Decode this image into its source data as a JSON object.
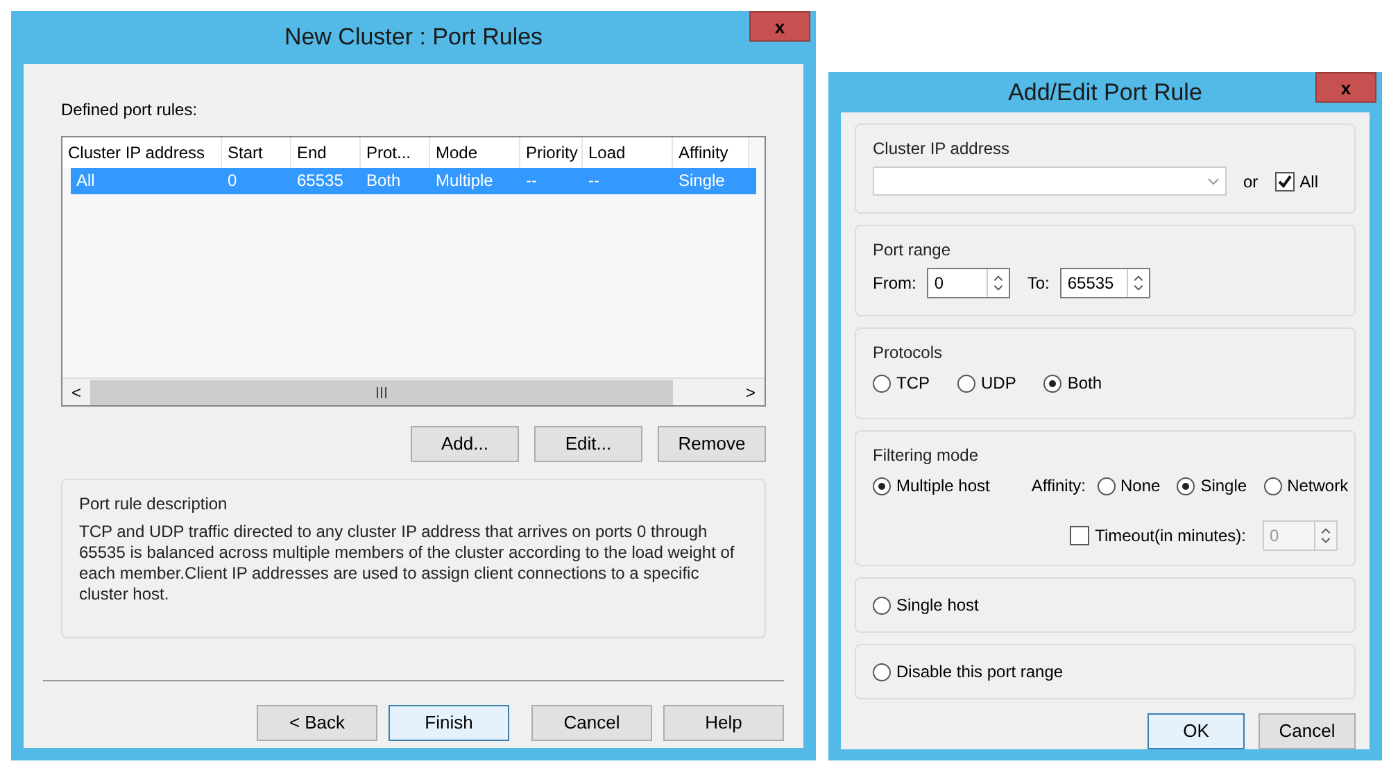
{
  "port_rules_dialog": {
    "title": "New Cluster :  Port Rules",
    "close": "x",
    "list_label": "Defined port rules:",
    "columns": [
      "Cluster IP address",
      "Start",
      "End",
      "Prot...",
      "Mode",
      "Priority",
      "Load",
      "Affinity"
    ],
    "rows": [
      {
        "cells": [
          "All",
          "0",
          "65535",
          "Both",
          "Multiple",
          "--",
          "--",
          "Single"
        ],
        "selected": true
      }
    ],
    "scroll_arrows": [
      "<",
      ">"
    ],
    "list_buttons": [
      "Add...",
      "Edit...",
      "Remove"
    ],
    "description": {
      "legend": "Port rule description",
      "text": "TCP and UDP traffic directed to any cluster IP address that arrives on ports 0 through 65535 is balanced across multiple members of the cluster according to the load weight of each member.Client IP addresses are used to assign client connections to a specific cluster host."
    },
    "wizard_buttons": [
      {
        "label": "< Back",
        "default": false
      },
      {
        "label": "Finish",
        "default": true
      },
      {
        "label": "Cancel",
        "default": false
      },
      {
        "label": "Help",
        "default": false
      }
    ]
  },
  "edit_rule_dialog": {
    "title": "Add/Edit Port Rule",
    "close": "x",
    "cluster_ip": {
      "legend": "Cluster IP address",
      "or": "or",
      "all": {
        "label": "All",
        "checked": true
      }
    },
    "port_range": {
      "legend": "Port range",
      "from_label": "From:",
      "from": "0",
      "to_label": "To:",
      "to": "65535"
    },
    "protocols": {
      "legend": "Protocols",
      "options": [
        {
          "label": "TCP",
          "selected": false
        },
        {
          "label": "UDP",
          "selected": false
        },
        {
          "label": "Both",
          "selected": true
        }
      ]
    },
    "filtering": {
      "legend": "Filtering mode",
      "modes": [
        {
          "label": "Multiple host",
          "selected": true
        },
        {
          "label": "Single host",
          "selected": false
        },
        {
          "label": "Disable this port range",
          "selected": false
        }
      ],
      "affinity_label": "Affinity:",
      "affinity": [
        {
          "label": "None",
          "selected": false
        },
        {
          "label": "Single",
          "selected": true
        },
        {
          "label": "Network",
          "selected": false
        }
      ],
      "timeout": {
        "label": "Timeout(in minutes):",
        "checked": false,
        "value": "0",
        "disabled": true
      }
    },
    "buttons": [
      {
        "label": "OK",
        "default": true
      },
      {
        "label": "Cancel",
        "default": false
      }
    ]
  }
}
